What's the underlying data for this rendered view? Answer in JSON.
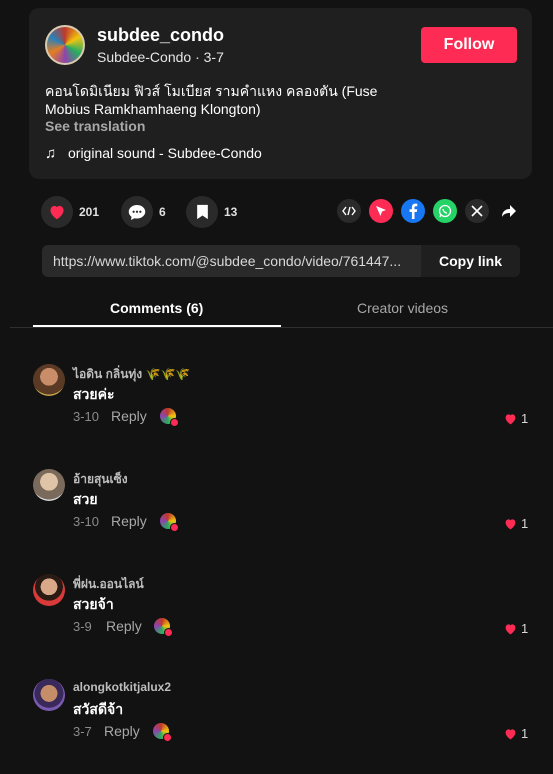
{
  "header": {
    "username": "subdee_condo",
    "subline": "Subdee-Condo · 3-7",
    "follow_label": "Follow",
    "description": "คอนโดมิเนียม ฟิวส์ โมเบียส รามคำแหง คลองตัน (Fuse Mobius Ramkhamhaeng Klongton)",
    "see_translation": "See translation",
    "sound_icon": "♫",
    "sound": "original sound - Subdee-Condo"
  },
  "actions": {
    "likes": "201",
    "comments": "6",
    "saves": "13"
  },
  "share": {
    "icons": [
      "embed-icon",
      "send-to-friends-icon",
      "facebook-icon",
      "whatsapp-icon",
      "x-icon",
      "share-arrow-icon"
    ]
  },
  "link": {
    "url": "https://www.tiktok.com/@subdee_condo/video/761447...",
    "copy_label": "Copy link"
  },
  "tabs": {
    "comments": "Comments (6)",
    "creator_videos": "Creator videos"
  },
  "comments": [
    {
      "name": "ไอดิน กลิ่นทุ่ง 🌾🌾🌾",
      "text": "สวยค่ะ",
      "date": "3-10",
      "reply": "Reply",
      "likes": "1"
    },
    {
      "name": "อ้ายสุนเซ็ง",
      "text": "สวย",
      "date": "3-10",
      "reply": "Reply",
      "likes": "1"
    },
    {
      "name": "พี่ฝน.ออนไลน์",
      "text": "สวยจ้า",
      "date": "3-9",
      "reply": "Reply",
      "likes": "1"
    },
    {
      "name": "alongkotkitjalux2",
      "text": "สวัสดีจ้า",
      "date": "3-7",
      "reply": "Reply",
      "likes": "1"
    }
  ],
  "colors": {
    "background": "#121212",
    "panel": "#1f1f1f",
    "accent": "#fe2c55",
    "facebook": "#1877f2",
    "whatsapp": "#25d366"
  }
}
